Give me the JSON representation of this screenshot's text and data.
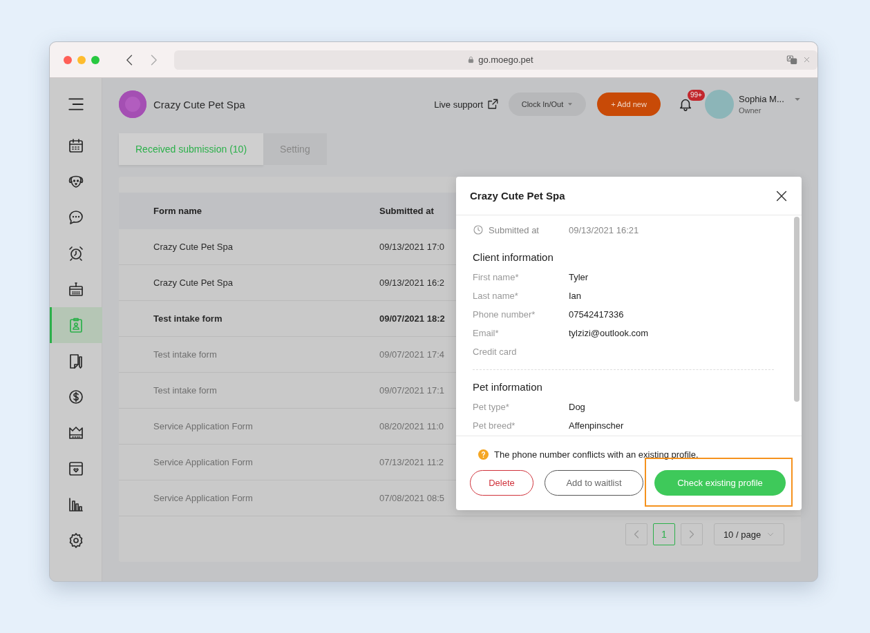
{
  "browser": {
    "url": "go.moego.pet"
  },
  "header": {
    "business_name": "Crazy Cute Pet Spa",
    "live_support": "Live support",
    "clock_button": "Clock In/Out",
    "add_button": "+ Add new",
    "notification_badge": "99+",
    "user": {
      "name": "Sophia M...",
      "role": "Owner"
    }
  },
  "sidebar": {
    "items": [
      {
        "selected": false
      },
      {
        "selected": false
      },
      {
        "selected": false
      },
      {
        "selected": false
      },
      {
        "selected": false
      },
      {
        "selected": true
      },
      {
        "selected": false
      },
      {
        "selected": false
      },
      {
        "selected": false
      },
      {
        "selected": false
      },
      {
        "selected": false
      },
      {
        "selected": false
      }
    ]
  },
  "tabs": [
    {
      "label": "Received submission (10)",
      "selected": true
    },
    {
      "label": "Setting",
      "selected": false
    }
  ],
  "table": {
    "columns": [
      "Form name",
      "Submitted at"
    ],
    "rows": [
      {
        "form_name": "Crazy Cute Pet Spa",
        "submitted_at": "09/13/2021 17:0",
        "read": false,
        "highlighted": false
      },
      {
        "form_name": "Crazy Cute Pet Spa",
        "submitted_at": "09/13/2021 16:2",
        "read": false,
        "highlighted": false
      },
      {
        "form_name": "Test intake form",
        "submitted_at": "09/07/2021 18:2",
        "read": false,
        "highlighted": true
      },
      {
        "form_name": "Test intake form",
        "submitted_at": "09/07/2021 17:4",
        "read": true,
        "highlighted": false
      },
      {
        "form_name": "Test intake form",
        "submitted_at": "09/07/2021 17:1",
        "read": true,
        "highlighted": false
      },
      {
        "form_name": "Service Application Form",
        "submitted_at": "08/20/2021 11:0",
        "read": true,
        "highlighted": false
      },
      {
        "form_name": "Service Application Form",
        "submitted_at": "07/13/2021 11:2",
        "read": true,
        "highlighted": false
      },
      {
        "form_name": "Service Application Form",
        "submitted_at": "07/08/2021 08:5",
        "read": true,
        "highlighted": false
      }
    ]
  },
  "pagination": {
    "pages": [
      {
        "label": "1",
        "selected": true
      }
    ],
    "page_size": "10 / page"
  },
  "modal": {
    "title": "Crazy Cute Pet Spa",
    "submitted_label": "Submitted at",
    "submitted_value": "09/13/2021 16:21",
    "sections": [
      {
        "title": "Client information",
        "fields": [
          {
            "label": "First name*",
            "value": "Tyler"
          },
          {
            "label": "Last name*",
            "value": "Ian"
          },
          {
            "label": "Phone number*",
            "value": "07542417336"
          },
          {
            "label": "Email*",
            "value": "tylzizi@outlook.com"
          },
          {
            "label": "Credit card"
          }
        ]
      },
      {
        "title": "Pet information",
        "fields": [
          {
            "label": "Pet type*",
            "value": "Dog"
          },
          {
            "label": "Pet breed*",
            "value": "Affenpinscher"
          }
        ]
      }
    ],
    "warning": "The phone number conflicts with an existing profile.",
    "buttons": [
      {
        "label": "Delete",
        "kind": "danger",
        "highlighted": false
      },
      {
        "label": "Add to waitlist",
        "kind": "default",
        "highlighted": false
      },
      {
        "label": "Check existing profile",
        "kind": "primary",
        "highlighted": true
      }
    ]
  }
}
